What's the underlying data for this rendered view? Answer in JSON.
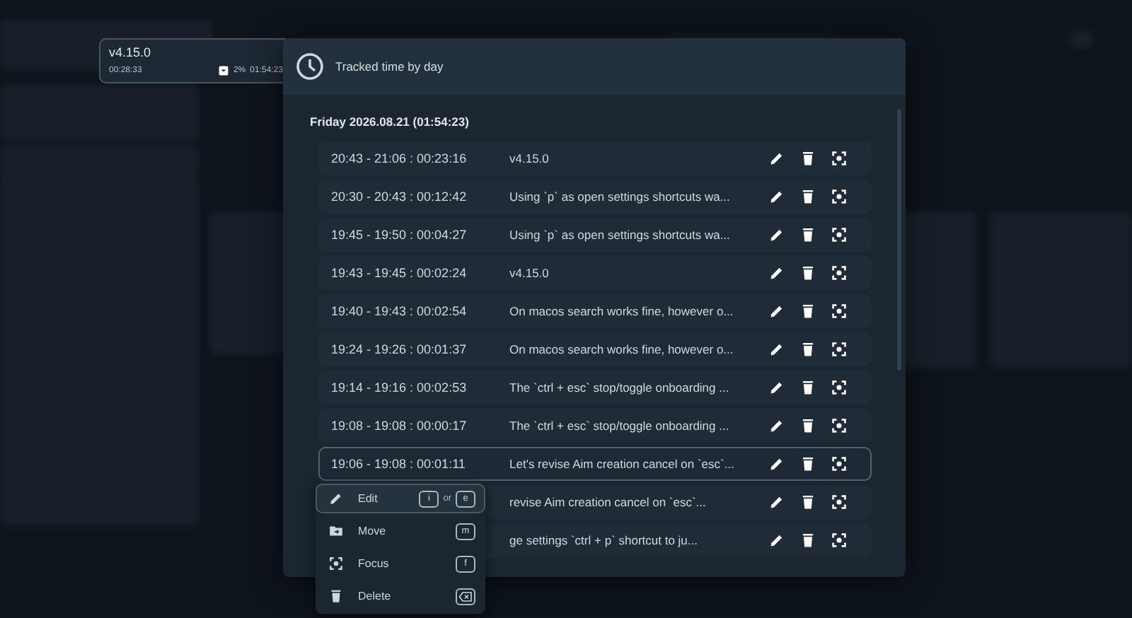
{
  "mini_timer": {
    "title": "v4.15.0",
    "elapsed": "00:28:33",
    "percent": "2%",
    "total": "01:54:23"
  },
  "dialog": {
    "title": "Tracked time by day",
    "day_heading": "Friday 2026.08.21 (01:54:23)",
    "entries": [
      {
        "time": "20:43 - 21:06 : 00:23:16",
        "description": "v4.15.0",
        "hovered": false
      },
      {
        "time": "20:30 - 20:43 : 00:12:42",
        "description": "Using `p` as open settings shortcuts wa...",
        "hovered": false
      },
      {
        "time": "19:45 - 19:50 : 00:04:27",
        "description": "Using `p` as open settings shortcuts wa...",
        "hovered": false
      },
      {
        "time": "19:43 - 19:45 : 00:02:24",
        "description": "v4.15.0",
        "hovered": false
      },
      {
        "time": "19:40 - 19:43 : 00:02:54",
        "description": "On macos search works fine, however o...",
        "hovered": false
      },
      {
        "time": "19:24 - 19:26 : 00:01:37",
        "description": "On macos search works fine, however o...",
        "hovered": false
      },
      {
        "time": "19:14 - 19:16 : 00:02:53",
        "description": "The `ctrl + esc` stop/toggle onboarding ...",
        "hovered": false
      },
      {
        "time": "19:08 - 19:08 : 00:00:17",
        "description": "The `ctrl + esc` stop/toggle onboarding ...",
        "hovered": false
      },
      {
        "time": "19:06 - 19:08 : 00:01:11",
        "description": "Let's revise Aim creation cancel on `esc`...",
        "hovered": true
      },
      {
        "description": "revise Aim creation cancel on `esc`...",
        "hovered": false
      },
      {
        "description": "ge settings `ctrl + p` shortcut to ju...",
        "hovered": false
      }
    ]
  },
  "context_menu": {
    "items": [
      {
        "kind": "pencil",
        "label": "Edit",
        "selected": true,
        "shortcut": [
          {
            "kind": "key",
            "text": "i"
          },
          {
            "kind": "word",
            "text": "or"
          },
          {
            "kind": "key",
            "text": "e"
          }
        ]
      },
      {
        "kind": "folder",
        "label": "Move",
        "selected": false,
        "shortcut": [
          {
            "kind": "key",
            "text": "m"
          }
        ]
      },
      {
        "kind": "focus",
        "label": "Focus",
        "selected": false,
        "shortcut": [
          {
            "kind": "key",
            "text": "f"
          }
        ]
      },
      {
        "kind": "trash",
        "label": "Delete",
        "selected": false,
        "shortcut": [
          {
            "kind": "backspace"
          }
        ]
      }
    ]
  }
}
